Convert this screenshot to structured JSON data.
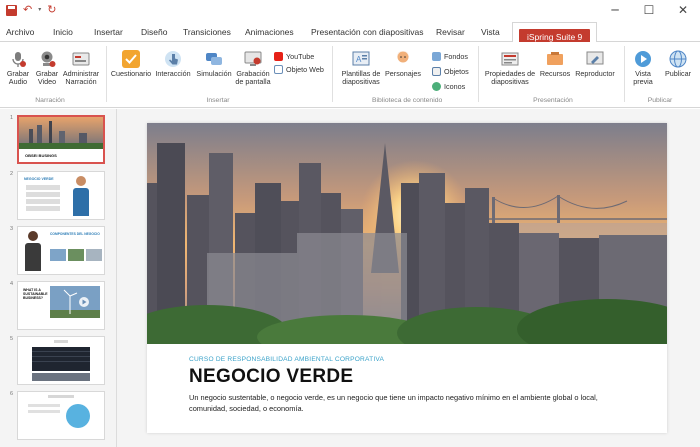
{
  "window": {
    "controls": {
      "minimize": "─",
      "maximize": "☐",
      "close": "✕"
    }
  },
  "quick_access": {
    "undo": "↶",
    "redo": "↻",
    "dropdown": "▾"
  },
  "tabs": [
    {
      "label": "Archivo"
    },
    {
      "label": "Inicio"
    },
    {
      "label": "Insertar"
    },
    {
      "label": "Diseño"
    },
    {
      "label": "Transiciones"
    },
    {
      "label": "Animaciones"
    },
    {
      "label": "Presentación con diapositivas"
    },
    {
      "label": "Revisar"
    },
    {
      "label": "Vista"
    },
    {
      "label": "iSpring Suite 9"
    }
  ],
  "ribbon": {
    "narracion": {
      "label": "Narración",
      "grabar_audio": "Grabar Audio",
      "grabar_video": "Grabar Video",
      "administrar": "Administrar Narración"
    },
    "insertar": {
      "label": "Insertar",
      "cuestionario": "Cuestionario",
      "interaccion": "Interacción",
      "simulacion": "Simulación",
      "grabacion": "Grabación de pantalla",
      "youtube": "YouTube",
      "objeto_web": "Objeto Web"
    },
    "biblioteca": {
      "label": "Biblioteca de contenido",
      "plantillas": "Plantillas de diapositivas",
      "personajes": "Personajes",
      "fondos": "Fondos",
      "objetos": "Objetos",
      "iconos": "Iconos"
    },
    "presentacion": {
      "label": "Presentación",
      "propiedades": "Propiedades de diapositivas",
      "recursos": "Recursos",
      "reproductor": "Reproductor"
    },
    "publicar": {
      "label": "Publicar",
      "vista_previa": "Vista previa",
      "publicar": "Publicar"
    }
  },
  "thumbnails": [
    {
      "num": "1",
      "text": "OBSEI BUSINGS"
    },
    {
      "num": "2",
      "text": "NEGOCIO VERDE"
    },
    {
      "num": "3",
      "text": "COMPONENTES DEL NEGOCIO"
    },
    {
      "num": "4",
      "text": "WHAT IS A SUSTAINABLE BUSINESS?"
    },
    {
      "num": "5",
      "text": ""
    },
    {
      "num": "6",
      "text": ""
    }
  ],
  "slide": {
    "kicker": "CURSO DE RESPONSABILIDAD AMBIENTAL CORPORATIVA",
    "title": "NEGOCIO VERDE",
    "body": "Un negocio sustentable, o negocio verde, es un negocio que tiene un impacto negativo mínimo en el ambiente global o local, comunidad, sociedad, o economía."
  },
  "colors": {
    "accent": "#c43b2e",
    "kicker": "#3aa2c9",
    "selected_thumb": "#d9534f"
  }
}
